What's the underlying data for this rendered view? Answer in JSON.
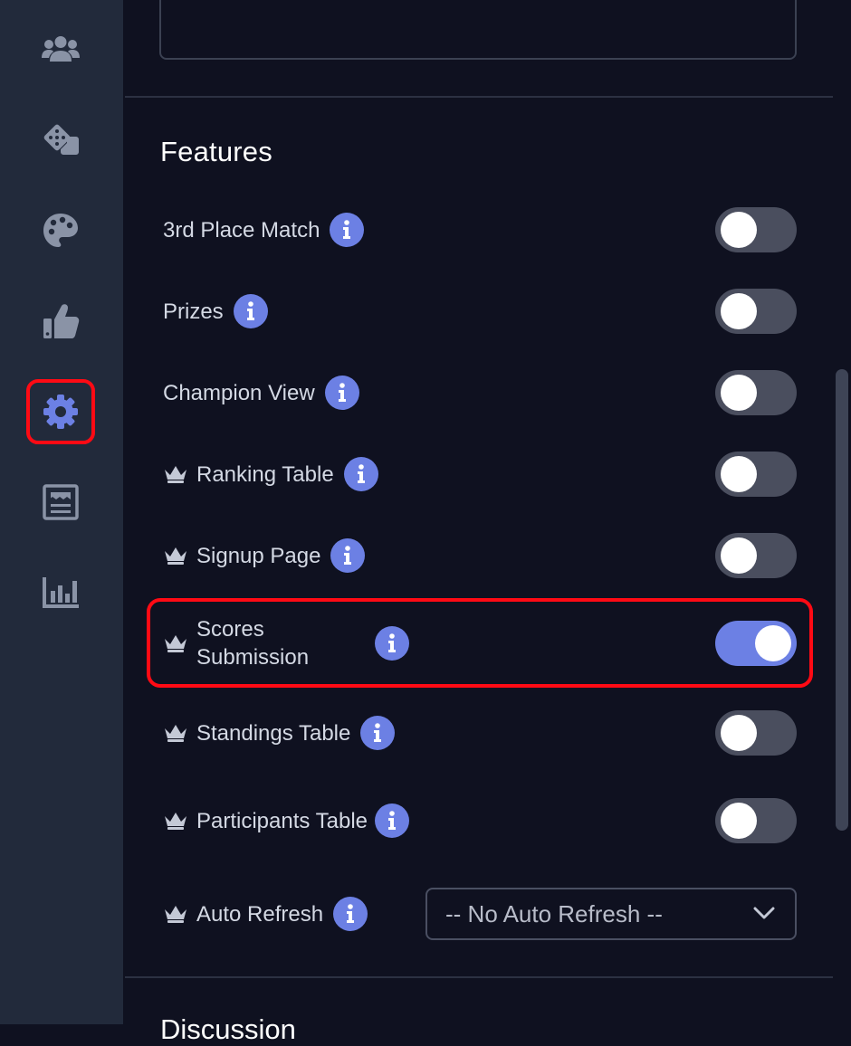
{
  "sidebar": {
    "items": [
      {
        "icon": "users-icon",
        "active": false
      },
      {
        "icon": "dice-icon",
        "active": false
      },
      {
        "icon": "palette-icon",
        "active": false
      },
      {
        "icon": "thumbs-up-icon",
        "active": false
      },
      {
        "icon": "gear-icon",
        "active": true
      },
      {
        "icon": "newspaper-icon",
        "active": false
      },
      {
        "icon": "chart-icon",
        "active": false
      }
    ],
    "icon_color": "#8a93a6",
    "active_icon_color": "#6c80e4"
  },
  "features": {
    "title": "Features",
    "rows": [
      {
        "label": "3rd Place Match",
        "premium": false,
        "enabled": false
      },
      {
        "label": "Prizes",
        "premium": false,
        "enabled": false
      },
      {
        "label": "Champion View",
        "premium": false,
        "enabled": false
      },
      {
        "label": "Ranking Table",
        "premium": true,
        "enabled": false
      },
      {
        "label": "Signup Page",
        "premium": true,
        "enabled": false
      },
      {
        "label": "Scores Submission",
        "premium": true,
        "enabled": true
      },
      {
        "label": "Standings Table",
        "premium": true,
        "enabled": false
      },
      {
        "label": "Participants Table",
        "premium": true,
        "enabled": false
      }
    ],
    "auto_refresh": {
      "label": "Auto Refresh",
      "premium": true,
      "selected": "-- No Auto Refresh --"
    }
  },
  "next_section": {
    "title": "Discussion"
  },
  "colors": {
    "accent": "#6c80e4",
    "highlight": "#ff0a14",
    "background": "#0f1120",
    "sidebar": "#222a3b"
  }
}
